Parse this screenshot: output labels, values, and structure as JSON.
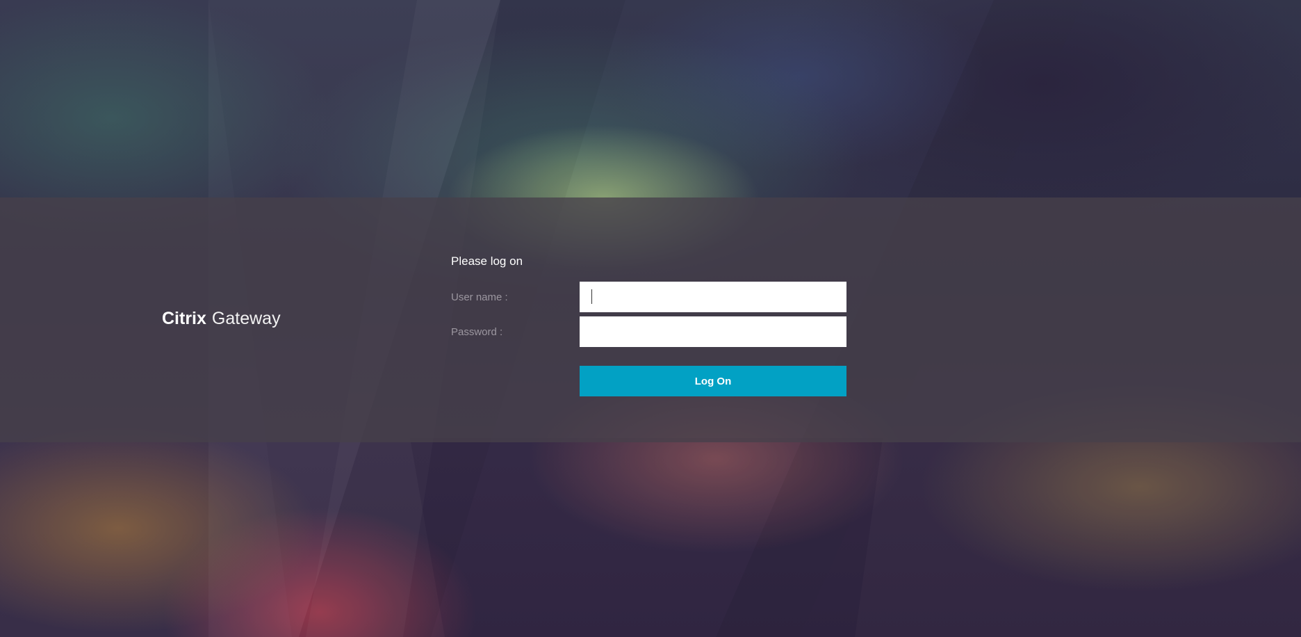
{
  "brand": {
    "name_bold": "Citrix",
    "name_light": "Gateway"
  },
  "form": {
    "heading": "Please log on",
    "username_label": "User name :",
    "username_value": "",
    "password_label": "Password :",
    "password_value": "",
    "submit_label": "Log On"
  },
  "colors": {
    "accent": "#02a1c4",
    "band": "#46404a",
    "label": "#9c97a0"
  }
}
